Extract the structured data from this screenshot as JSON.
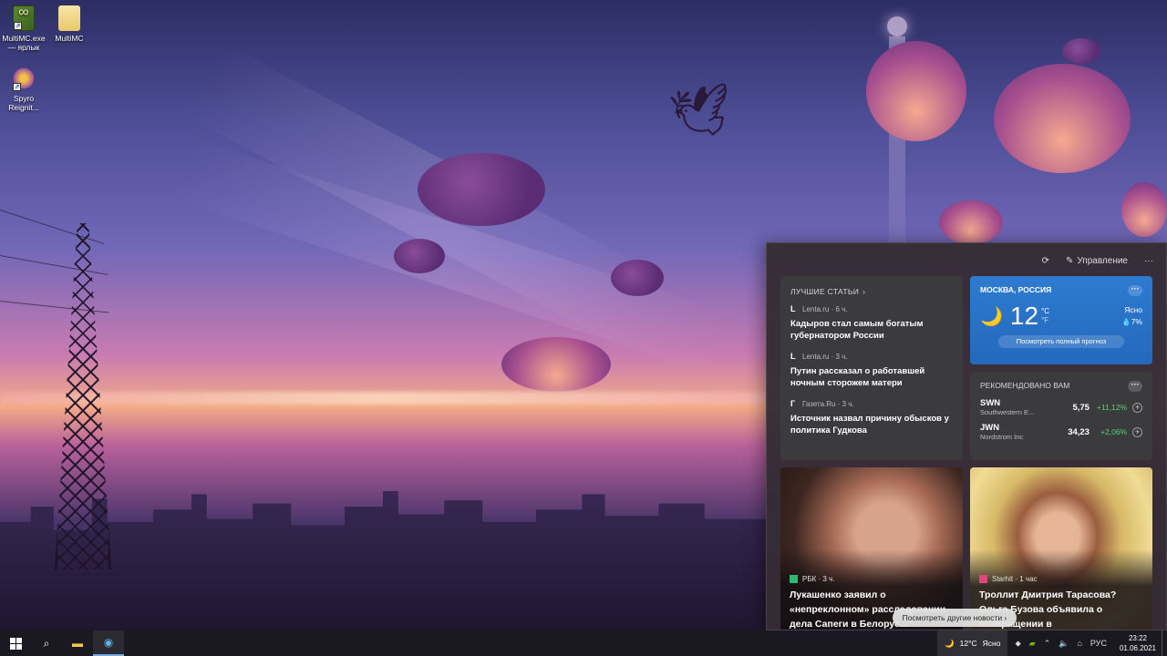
{
  "desktop": {
    "icons": [
      {
        "label": "MultiMC.exe — ярлык",
        "icon": "multimc-icon"
      },
      {
        "label": "MultiMC",
        "icon": "folder-icon"
      },
      {
        "label": "Spyro Reignit...",
        "icon": "spyro-icon"
      }
    ]
  },
  "widgets": {
    "toolbar": {
      "refresh_icon": "refresh-icon",
      "manage_label": "Управление",
      "more_label": "···"
    },
    "top_stories": {
      "title": "ЛУЧШИЕ СТАТЬИ",
      "articles": [
        {
          "logo": "L",
          "source": "Lenta.ru · 6 ч.",
          "headline": "Кадыров стал самым богатым губернатором России"
        },
        {
          "logo": "L",
          "source": "Lenta.ru · 3 ч.",
          "headline": "Путин рассказал о работавшей ночным сторожем матери"
        },
        {
          "logo": "Г",
          "source": "Газета.Ru · 3 ч.",
          "headline": "Источник назвал причину обысков у политика Гудкова"
        }
      ]
    },
    "weather": {
      "location": "МОСКВА, РОССИЯ",
      "more": "···",
      "temp": "12",
      "unit_c": "°C",
      "unit_f": "°F",
      "condition": "Ясно",
      "precip": "💧7%",
      "forecast_button": "Посмотреть полный прогноз"
    },
    "stocks": {
      "title": "РЕКОМЕНДОВАНО ВАМ",
      "more": "···",
      "items": [
        {
          "symbol": "SWN",
          "company": "Southwestern E...",
          "price": "5,75",
          "change": "+11,12%"
        },
        {
          "symbol": "JWN",
          "company": "Nordstrom Inc",
          "price": "34,23",
          "change": "+2,06%"
        }
      ]
    },
    "photo_news": [
      {
        "source": "РБК · 3 ч.",
        "headline": "Лукашенко заявил о «непреклонном» расследовании дела Сапеги в Белорус..."
      },
      {
        "source": "Starhit · 1 час",
        "headline": "Троллит Дмитрия Тарасова? Ольга Бузова объявила о возвращении в"
      }
    ],
    "more_news_button": "Посмотреть другие новости ›"
  },
  "taskbar": {
    "weather_temp": "12°C",
    "weather_cond": "Ясно",
    "language": "РУС",
    "time": "23:22",
    "date": "01.06.2021"
  }
}
